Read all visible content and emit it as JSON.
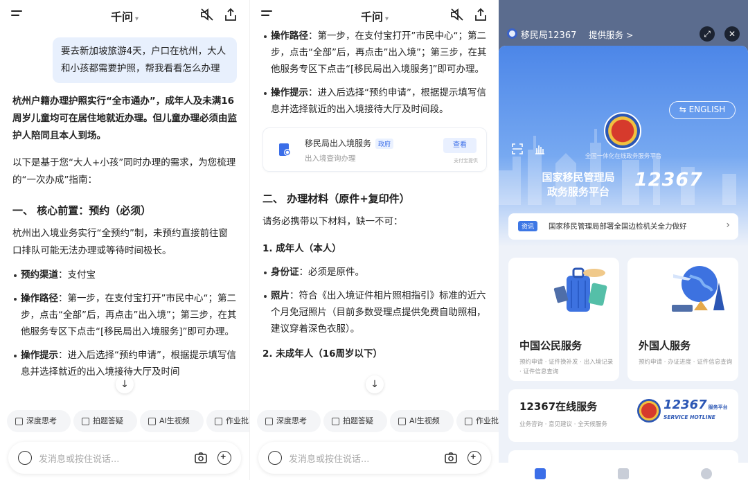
{
  "chat": {
    "title": "千问",
    "input_placeholder": "发消息或按住说话...",
    "chips": [
      {
        "label": "深度思考"
      },
      {
        "label": "拍题答疑"
      },
      {
        "label": "AI生视频"
      },
      {
        "label": "作业批改"
      }
    ],
    "scroll_down_icon": "arrow-down-icon"
  },
  "panel1": {
    "user_message": "要去新加坡旅游4天，户口在杭州，大人和小孩都需要护照，帮我看看怎么办理",
    "intro_bold": "杭州户籍办理护照实行“全市通办”，成年人及未满16周岁儿童均可在居住地就近办理。但儿童办理必须由监护人陪同且本人到场。",
    "intro2": "以下是基于您“大人+小孩”同时办理的需求，为您梳理的“一次办成”指南：",
    "section1": "一、 核心前置：预约（必须）",
    "section1_text": "杭州出入境业务实行“全预约”制，未预约直接前往窗口排队可能无法办理或等待时间极长。",
    "bullets": [
      {
        "label": "预约渠道",
        "text": "：支付宝"
      },
      {
        "label": "操作路径",
        "text": "：第一步，在支付宝打开”市民中心“；第二步，点击“全部”后，再点击”出入境”；第三步，在其他服务专区下点击“[移民局出入境服务]”即可办理。"
      },
      {
        "label": "操作提示",
        "text": "：进入后选择“预约申请”，根据提示填写信息并选择就近的出入境接待大厅及时间"
      }
    ]
  },
  "panel2": {
    "bullets": [
      {
        "label": "操作路径",
        "text": "：第一步，在支付宝打开”市民中心“；第二步，点击“全部”后，再点击”出入境”；第三步，在其他服务专区下点击“[移民局出入境服务]”即可办理。"
      },
      {
        "label": "操作提示",
        "text": "：进入后选择“预约申请”，根据提示填写信息并选择就近的出入境接待大厅及时间段。"
      }
    ],
    "service_card": {
      "name": "移民局出入境服务",
      "tag": "政府",
      "desc": "出入境查询办理",
      "button": "查看",
      "provider": "支付宝提供"
    },
    "section2": "二、 办理材料（原件+复印件）",
    "section2_text": "请务必携带以下材料，缺一不可：",
    "sub1": "1. 成年人（本人）",
    "bullets2": [
      {
        "label": "身份证",
        "text": "：必须是原件。"
      },
      {
        "label": "照片",
        "text": "：符合《出入境证件相片照相指引》标准的近六个月免冠照片（目前多数受理点提供免费自助照相，建议穿着深色衣服）。"
      }
    ],
    "sub2": "2. 未成年人（16周岁以下）"
  },
  "panel3": {
    "app_name": "移民局12367",
    "provide": "提供服务 >",
    "english_btn": "ENGLISH",
    "platform_small": "全国一体化在线政务服务平台",
    "platform_title": "国家移民管理局\n政务服务平台",
    "hotline": "12367",
    "news_tag": "资讯",
    "news_text": "国家移民管理局部署全国边检机关全力做好",
    "cards": [
      {
        "title": "中国公民服务",
        "desc": "预约申请 · 证件换补发 · 出入境记录 · 证件信息查询"
      },
      {
        "title": "外国人服务",
        "desc": "预约申请 · 办证进度 · 证件信息查询"
      }
    ],
    "online": {
      "title": "12367在线服务",
      "desc": "业务咨询 · 意见建议 · 全天候服务",
      "badge": "12367",
      "badge_sub": "SERVICE HOTLINE",
      "badge_cn": "服务平台"
    }
  },
  "colors": {
    "accent": "#3b6ee8",
    "bubble": "#e8f0fd",
    "hero": "#4c86e8"
  }
}
